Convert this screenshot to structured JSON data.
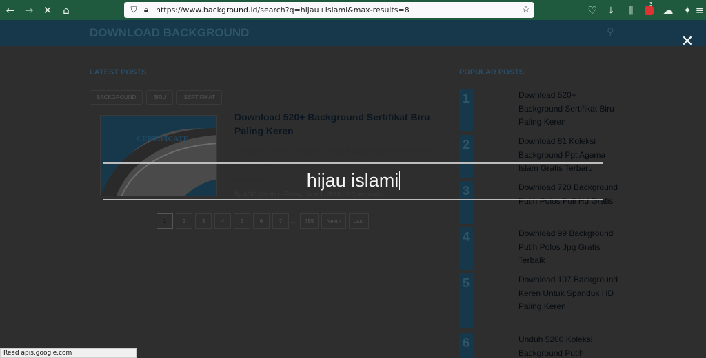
{
  "browser": {
    "url": "https://www.background.id/search?q=hijau+islami&max-results=8",
    "back_icon": "back-arrow-icon",
    "forward_icon": "forward-arrow-icon",
    "stop_icon": "stop-icon",
    "home_icon": "home-icon",
    "extension_badge": "3",
    "status_text": "Read apis.google.com"
  },
  "site": {
    "title": "DOWNLOAD BACKGROUND",
    "latest_title": "LATEST POSTS",
    "popular_title": "POPULAR POSTS",
    "tags": [
      "BACKGROUND",
      "BIRU",
      "SERTIFIKAT"
    ],
    "thumb_text": "CERTIFICATE",
    "post": {
      "title": "Download 520+ Background Sertifikat Biru Paling Keren",
      "excerpt": "Dihalaman ini anda akan melihat Background Sertifikat Biru yang keren! Gambar tersebut bisa anda unduh langsung, caranya",
      "meta": "By AGC Version - Friday, June 1, 2018 - 2 Comments"
    },
    "pagination": [
      "1",
      "2",
      "3",
      "4",
      "5",
      "6",
      "7",
      "...",
      "755",
      "Next ›",
      "Last"
    ],
    "popular": [
      {
        "num": "1",
        "text": "Download 520+ Background Sertifikat Biru Paling Keren"
      },
      {
        "num": "2",
        "text": "Download 81 Koleksi Background Ppt Agama Islam Gratis Terbaru"
      },
      {
        "num": "3",
        "text": "Download 720 Background Putih Polos Full Hd Gratis"
      },
      {
        "num": "4",
        "text": "Download 99 Background Putih Polos Jpg Gratis Terbaik"
      },
      {
        "num": "5",
        "text": "Download 107 Background Keren Untuk Spanduk HD Paling Keren"
      },
      {
        "num": "6",
        "text": "Unduh 5200 Koleksi Background Putih"
      }
    ]
  },
  "search_overlay": {
    "value": "hijau islami",
    "close_icon": "close-icon"
  }
}
